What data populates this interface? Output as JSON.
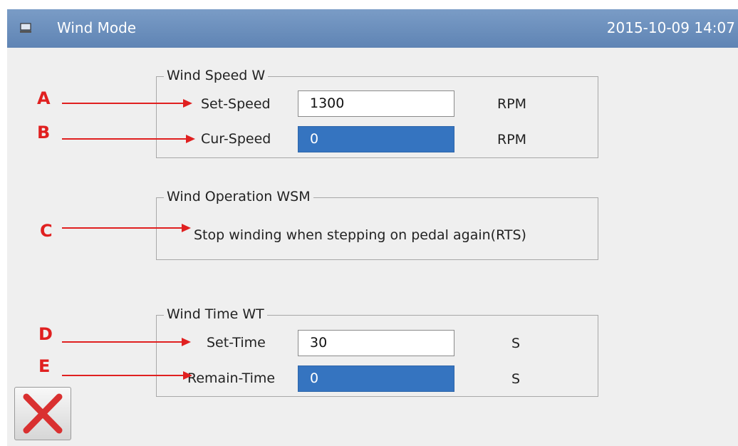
{
  "window": {
    "title": "Wind Mode",
    "datetime": "2015-10-09 14:07",
    "app_icon": "monitor-icon"
  },
  "wind_speed": {
    "legend": "Wind Speed W",
    "set_speed": {
      "label": "Set-Speed",
      "value": "1300",
      "unit": "RPM"
    },
    "cur_speed": {
      "label": "Cur-Speed",
      "value": "0",
      "unit": "RPM"
    }
  },
  "wind_operation": {
    "legend": "Wind Operation WSM",
    "option_text": "Stop winding when stepping on pedal again(RTS)"
  },
  "wind_time": {
    "legend": "Wind Time WT",
    "set_time": {
      "label": "Set-Time",
      "value": "30",
      "unit": "S"
    },
    "remain_time": {
      "label": "Remain-Time",
      "value": "0",
      "unit": "S"
    }
  },
  "annotations": [
    "A",
    "B",
    "C",
    "D",
    "E"
  ],
  "close_button": {
    "icon": "close-icon"
  },
  "colors": {
    "titlebar": "#6b8fbe",
    "display_field": "#3574c0",
    "annotation": "#e02020",
    "close_x": "#d93030"
  }
}
